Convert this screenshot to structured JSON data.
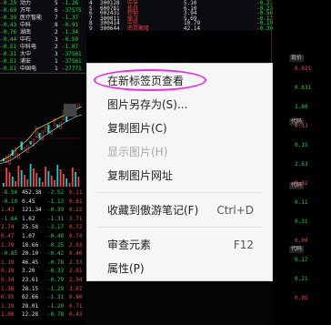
{
  "context_menu": {
    "items": [
      {
        "label": "在新标签页查看",
        "shortcut": "",
        "disabled": false
      },
      {
        "label": "图片另存为(S)...",
        "shortcut": "",
        "disabled": false
      },
      {
        "label": "复制图片(C)",
        "shortcut": "",
        "disabled": false
      },
      {
        "label": "显示图片(H)",
        "shortcut": "",
        "disabled": true
      },
      {
        "label": "复制图片网址",
        "shortcut": "",
        "disabled": false
      },
      {
        "label": "收藏到傲游笔记(F)",
        "shortcut": "Ctrl+D",
        "disabled": false
      },
      {
        "label": "审查元素",
        "shortcut": "F12",
        "disabled": false
      },
      {
        "label": "属性(P)",
        "shortcut": "",
        "disabled": false
      }
    ],
    "highlight_color": "#e62fe0"
  },
  "background": {
    "left_list": [
      {
        "num": "-0.29",
        "name": "动力",
        "val": "5",
        "chg": "-1.26"
      },
      {
        "num": "-0.69",
        "name": "万年",
        "val": "6",
        "chg": "-37575"
      },
      {
        "num": "-0.39",
        "name": "医疗智能",
        "val": "7",
        "chg": "-1.37"
      },
      {
        "num": "-0.43",
        "name": "中科",
        "val": "8",
        "chg": "-0.91"
      },
      {
        "num": "-0.76",
        "name": "湖南",
        "val": "2",
        "chg": "-1.34"
      },
      {
        "num": "-0.44",
        "name": "中石",
        "val": "3",
        "chg": "-0.59"
      },
      {
        "num": "-0.51",
        "name": "中科电",
        "val": "2",
        "chg": "-1.07"
      },
      {
        "num": "-0.31",
        "name": "大中",
        "val": "3",
        "chg": "-37561"
      },
      {
        "num": "-0.51",
        "name": "浦安",
        "val": "1",
        "chg": "-37561"
      },
      {
        "num": "-0.51",
        "name": "中国电",
        "val": "1",
        "chg": "-27771"
      }
    ],
    "top_mid_list": [
      {
        "n": "4",
        "code": "300128",
        "name": "中孚",
        "v1": "5.10",
        "v2": "-0.21"
      },
      {
        "n": "5",
        "code": "600781",
        "name": "拓日",
        "v1": "6.10",
        "v2": "-0.23"
      },
      {
        "n": "6",
        "code": "002431",
        "name": "棕榈",
        "v1": "3.94",
        "v2": "-0.56"
      },
      {
        "n": "7",
        "code": "300011",
        "name": "鼎汉",
        "v1": "5.69",
        "v2": "-0.12"
      },
      {
        "n": "8",
        "code": "300414",
        "name": "中光",
        "v1": "10.79",
        "v2": "-0.19"
      },
      {
        "n": "9",
        "code": "300644",
        "name": "南京聚隆",
        "v1": "42.14",
        "v2": "-0.30"
      }
    ],
    "bottom_table": [
      [
        "-8.54",
        "452.38",
        "-2.52",
        "0.21"
      ],
      [
        "-0.10",
        "0.45",
        "-1.13",
        "0.61"
      ],
      [
        "1.43",
        "121.34",
        "-0.39",
        "0.22"
      ],
      [
        "-1.64",
        "1.62",
        "-1.31",
        "3.71"
      ],
      [
        "2.74",
        "25.58",
        "-3.17",
        "0.72"
      ],
      [
        "0.47",
        "1.07",
        "-0.48",
        "0.74"
      ],
      [
        "1.79",
        "18.66",
        "-0.25",
        "2.03"
      ],
      [
        "-0.85",
        "20.10",
        "-0.42",
        "0.40"
      ],
      [
        "1.19",
        "46.45",
        "-0.78",
        "2.53"
      ],
      [
        "0.19",
        "3.20",
        "-0.33",
        "2.91"
      ],
      [
        "0.34",
        "23.61",
        "-0.79",
        "2.94"
      ],
      [
        "1.36",
        "28.15",
        "-1.29",
        "3.67"
      ],
      [
        "0.95",
        "62.66",
        "-1.31",
        "0.80"
      ],
      [
        "1.19",
        "28.01",
        "-1.20",
        "0.71"
      ],
      [
        "1.00",
        "12.28",
        "-0.78",
        "0.43"
      ]
    ],
    "right_tags": [
      "现价",
      "代码",
      "代码",
      "代码"
    ],
    "right_list": [
      "0.021",
      "0.631",
      "1.80",
      "0.13",
      "0.15",
      "2.63",
      "0.02",
      "0.11",
      "0.31",
      "0.09",
      "0.17",
      "0.21",
      "0.05"
    ]
  }
}
